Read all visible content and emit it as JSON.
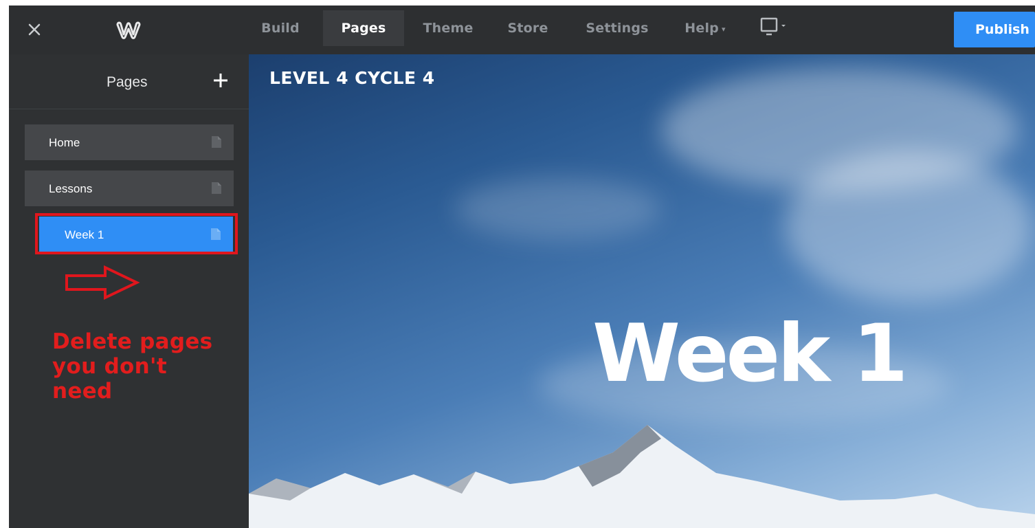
{
  "topbar": {
    "close_icon": "close-icon",
    "logo_icon": "weebly-logo-icon",
    "nav": [
      {
        "label": "Build"
      },
      {
        "label": "Pages"
      },
      {
        "label": "Theme"
      },
      {
        "label": "Store"
      },
      {
        "label": "Settings"
      },
      {
        "label": "Help"
      }
    ],
    "active_tab": "Pages",
    "device_icon": "device-preview-icon",
    "publish_label": "Publish"
  },
  "sidebar": {
    "title": "Pages",
    "add_icon": "plus-icon",
    "pages": [
      {
        "label": "Home"
      },
      {
        "label": "Lessons"
      },
      {
        "label": "Week 1"
      }
    ],
    "selected_page": "Week 1",
    "annotation": "Delete pages you don't need"
  },
  "canvas": {
    "site_title": "LEVEL 4 CYCLE 4",
    "hero_title": "Week 1"
  },
  "colors": {
    "topbar_bg": "#2d2f31",
    "sidebar_bg": "#2f3133",
    "page_item_bg": "#45474a",
    "accent_blue": "#2f8ef5",
    "annotation_red": "#e21d1d"
  }
}
